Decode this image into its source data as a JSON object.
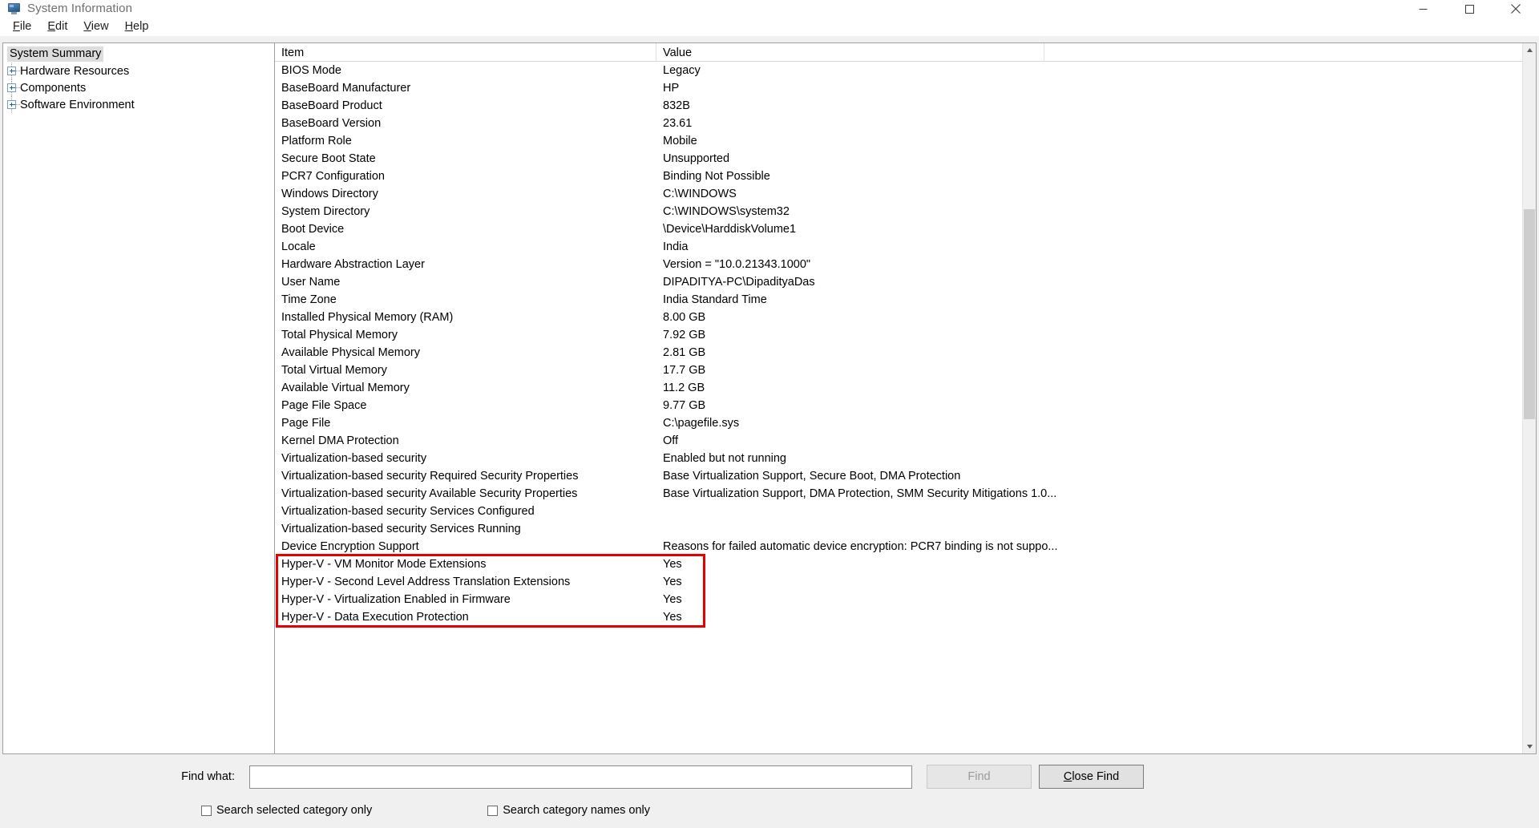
{
  "window": {
    "title": "System Information",
    "icon": "system-information-icon",
    "controls": {
      "minimize": "minimize-icon",
      "maximize": "maximize-icon",
      "close": "close-icon"
    }
  },
  "menubar": {
    "items": [
      {
        "label": "File"
      },
      {
        "label": "Edit"
      },
      {
        "label": "View"
      },
      {
        "label": "Help"
      }
    ]
  },
  "tree": {
    "root": "System Summary",
    "children": [
      {
        "label": "Hardware Resources",
        "expander": "plus-icon"
      },
      {
        "label": "Components",
        "expander": "plus-icon"
      },
      {
        "label": "Software Environment",
        "expander": "plus-icon"
      }
    ]
  },
  "table": {
    "columns": [
      "Item",
      "Value"
    ],
    "rows": [
      {
        "item": "BIOS Mode",
        "value": "Legacy"
      },
      {
        "item": "BaseBoard Manufacturer",
        "value": "HP"
      },
      {
        "item": "BaseBoard Product",
        "value": "832B"
      },
      {
        "item": "BaseBoard Version",
        "value": "23.61"
      },
      {
        "item": "Platform Role",
        "value": "Mobile"
      },
      {
        "item": "Secure Boot State",
        "value": "Unsupported"
      },
      {
        "item": "PCR7 Configuration",
        "value": "Binding Not Possible"
      },
      {
        "item": "Windows Directory",
        "value": "C:\\WINDOWS"
      },
      {
        "item": "System Directory",
        "value": "C:\\WINDOWS\\system32"
      },
      {
        "item": "Boot Device",
        "value": "\\Device\\HarddiskVolume1"
      },
      {
        "item": "Locale",
        "value": "India"
      },
      {
        "item": "Hardware Abstraction Layer",
        "value": "Version = \"10.0.21343.1000\""
      },
      {
        "item": "User Name",
        "value": "DIPADITYA-PC\\DipadityaDas"
      },
      {
        "item": "Time Zone",
        "value": "India Standard Time"
      },
      {
        "item": "Installed Physical Memory (RAM)",
        "value": "8.00 GB"
      },
      {
        "item": "Total Physical Memory",
        "value": "7.92 GB"
      },
      {
        "item": "Available Physical Memory",
        "value": "2.81 GB"
      },
      {
        "item": "Total Virtual Memory",
        "value": "17.7 GB"
      },
      {
        "item": "Available Virtual Memory",
        "value": "11.2 GB"
      },
      {
        "item": "Page File Space",
        "value": "9.77 GB"
      },
      {
        "item": "Page File",
        "value": "C:\\pagefile.sys"
      },
      {
        "item": "Kernel DMA Protection",
        "value": "Off"
      },
      {
        "item": "Virtualization-based security",
        "value": "Enabled but not running"
      },
      {
        "item": "Virtualization-based security Required Security Properties",
        "value": "Base Virtualization Support, Secure Boot, DMA Protection"
      },
      {
        "item": "Virtualization-based security Available Security Properties",
        "value": "Base Virtualization Support, DMA Protection, SMM Security Mitigations 1.0..."
      },
      {
        "item": "Virtualization-based security Services Configured",
        "value": ""
      },
      {
        "item": "Virtualization-based security Services Running",
        "value": ""
      },
      {
        "item": "Device Encryption Support",
        "value": "Reasons for failed automatic device encryption: PCR7 binding is not suppo..."
      },
      {
        "item": "Hyper-V - VM Monitor Mode Extensions",
        "value": "Yes"
      },
      {
        "item": "Hyper-V - Second Level Address Translation Extensions",
        "value": "Yes"
      },
      {
        "item": "Hyper-V - Virtualization Enabled in Firmware",
        "value": "Yes"
      },
      {
        "item": "Hyper-V - Data Execution Protection",
        "value": "Yes"
      }
    ]
  },
  "annotation": {
    "highlight_color": "#e60000",
    "highlighted_rows": [
      "Hyper-V - VM Monitor Mode Extensions",
      "Hyper-V - Second Level Address Translation Extensions",
      "Hyper-V - Virtualization Enabled in Firmware",
      "Hyper-V - Data Execution Protection"
    ]
  },
  "findbar": {
    "label": "Find what:",
    "input_value": "",
    "input_placeholder": "",
    "find_button": "Find",
    "close_find_button": "Close Find",
    "checkbox_selected_category": "Search selected category only",
    "checkbox_category_names": "Search category names only",
    "checkbox_selected_category_checked": false,
    "checkbox_category_names_checked": false
  },
  "scrollbar": {
    "up_arrow": "chevron-up-icon",
    "down_arrow": "chevron-down-icon"
  }
}
